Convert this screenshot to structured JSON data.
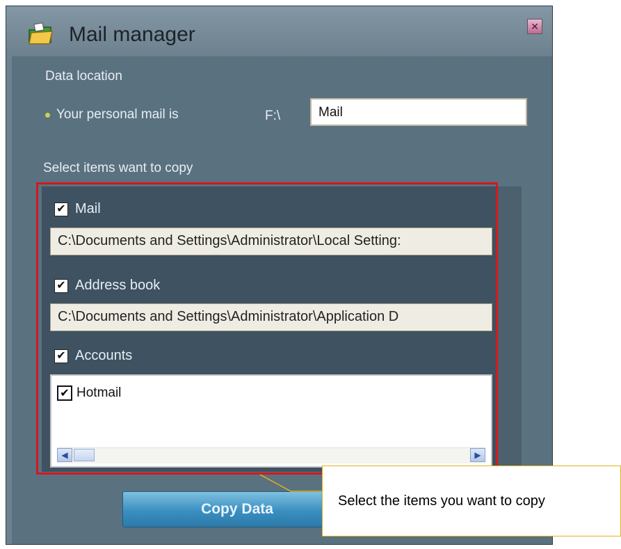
{
  "window": {
    "title": "Mail manager",
    "close_icon": "close-icon"
  },
  "data_location": {
    "heading": "Data location",
    "personal_mail_label": "Your personal mail is",
    "drive": "F:\\",
    "mail_folder_value": "Mail"
  },
  "items": {
    "heading": "Select items want to copy",
    "mail": {
      "label": "Mail",
      "checked": true,
      "path": "C:\\Documents and Settings\\Administrator\\Local Setting:"
    },
    "address_book": {
      "label": "Address book",
      "checked": true,
      "path": "C:\\Documents and Settings\\Administrator\\Application D"
    },
    "accounts": {
      "label": "Accounts",
      "checked": true,
      "list": [
        {
          "name": "Hotmail",
          "checked": true
        }
      ]
    }
  },
  "actions": {
    "copy_button_label": "Copy Data"
  },
  "callout": {
    "text": "Select the items you want to copy"
  },
  "colors": {
    "highlight": "#d4181e",
    "panel": "#3e5261",
    "window": "#5a7180",
    "callout_border": "#e4b21a"
  }
}
